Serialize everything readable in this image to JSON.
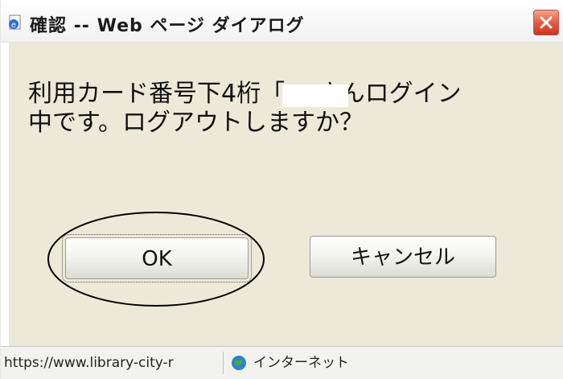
{
  "titlebar": {
    "title": "確認 -- Web ページ ダイアログ",
    "page_icon": "ie-page-icon",
    "close_icon": "close-icon",
    "close_color": "#e4583c"
  },
  "dialog": {
    "message": "利用カード番号下4桁「        」さんログイン\n中です。ログアウトしますか？",
    "ok_label": "OK",
    "cancel_label": "キャンセル"
  },
  "statusbar": {
    "url": "https://www.library-city-r",
    "zone_icon": "globe-icon",
    "zone_label": "インターネット"
  }
}
